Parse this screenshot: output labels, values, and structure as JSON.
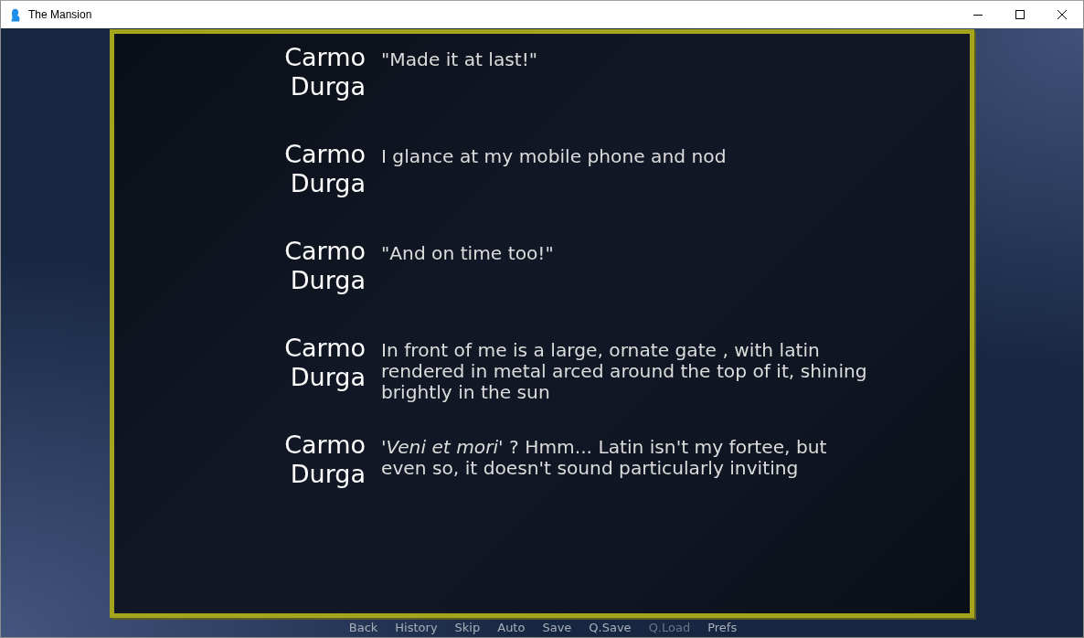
{
  "window": {
    "title": "The Mansion"
  },
  "dialogue": [
    {
      "speaker": "Carmo Durga",
      "text": "\"Made it at last!\""
    },
    {
      "speaker": "Carmo Durga",
      "text": "I glance at my mobile phone and nod"
    },
    {
      "speaker": "Carmo Durga",
      "text": "\"And on time too!\""
    },
    {
      "speaker": "Carmo Durga",
      "text": "In front of me is a large, ornate gate , with latin rendered in metal arced around the top of it, shining brightly in the sun"
    },
    {
      "speaker": "Carmo Durga",
      "text": "'*Veni et mori*' ? Hmm... Latin isn't my fortee, but even so, it doesn't sound particularly inviting"
    }
  ],
  "quick_menu": [
    {
      "label": "Back",
      "disabled": false
    },
    {
      "label": "History",
      "disabled": false
    },
    {
      "label": "Skip",
      "disabled": false
    },
    {
      "label": "Auto",
      "disabled": false
    },
    {
      "label": "Save",
      "disabled": false
    },
    {
      "label": "Q.Save",
      "disabled": false
    },
    {
      "label": "Q.Load",
      "disabled": true
    },
    {
      "label": "Prefs",
      "disabled": false
    }
  ]
}
